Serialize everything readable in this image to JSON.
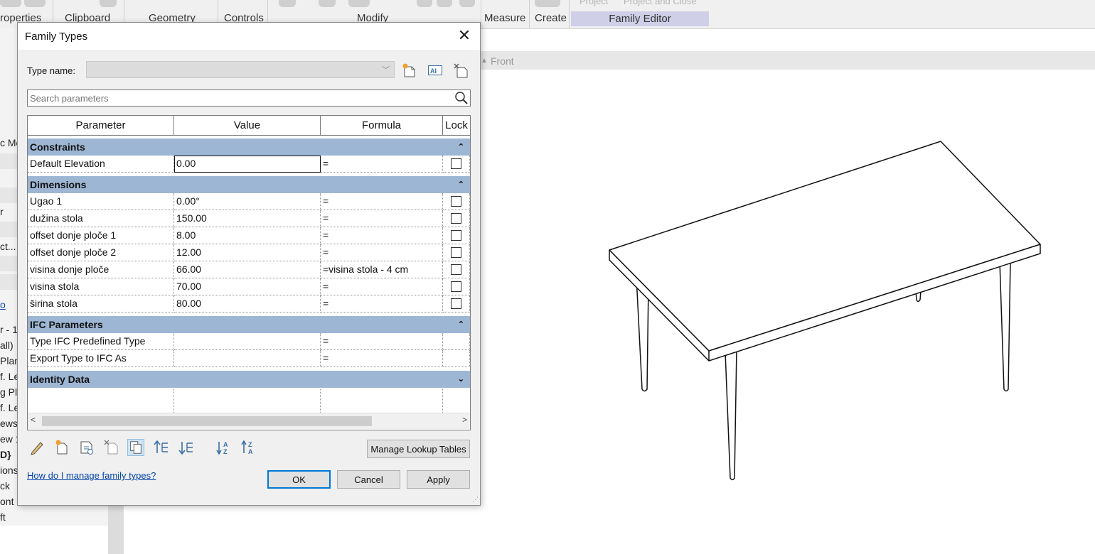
{
  "ribbon": {
    "groups": [
      "roperties",
      "Clipboard",
      "Geometry",
      "Controls",
      "Modify",
      "Measure",
      "Create",
      "Family Editor"
    ],
    "faded_labels": [
      "Project",
      "Project and Close"
    ]
  },
  "left_panel": {
    "fragments": [
      "c Mo",
      "r",
      "ct...",
      "o",
      "r - 1",
      "all)",
      "Plan",
      "f. Le",
      "g Pla",
      "f. Le",
      "ews",
      "ew 1",
      "D}",
      "ions",
      "ck",
      "ont",
      "ft"
    ]
  },
  "view": {
    "tab_label": "Front"
  },
  "dialog": {
    "title": "Family Types",
    "close_glyph": "✕",
    "type_name_label": "Type name:",
    "type_name_value": "",
    "search_placeholder": "Search parameters",
    "columns": [
      "Parameter",
      "Value",
      "Formula",
      "Lock"
    ],
    "groups": [
      {
        "name": "Constraints",
        "collapse_glyph": "⌃",
        "rows": [
          {
            "param": "Default Elevation",
            "value": "0.00",
            "formula": "=",
            "lock": true
          }
        ]
      },
      {
        "name": "Dimensions",
        "collapse_glyph": "⌃",
        "rows": [
          {
            "param": "Ugao 1",
            "value": "0.00°",
            "formula": "=",
            "lock": true
          },
          {
            "param": "dužina stola",
            "value": "150.00",
            "formula": "=",
            "lock": true
          },
          {
            "param": "offset donje ploče 1",
            "value": "8.00",
            "formula": "=",
            "lock": true
          },
          {
            "param": "offset donje ploče 2",
            "value": "12.00",
            "formula": "=",
            "lock": true
          },
          {
            "param": "visina donje ploče",
            "value": "66.00",
            "formula": "=visina stola - 4 cm",
            "lock": true
          },
          {
            "param": "visina stola",
            "value": "70.00",
            "formula": "=",
            "lock": true
          },
          {
            "param": "širina stola",
            "value": "80.00",
            "formula": "=",
            "lock": true
          }
        ]
      },
      {
        "name": "IFC Parameters",
        "collapse_glyph": "⌃",
        "rows": [
          {
            "param": "Type IFC Predefined Type",
            "value": "",
            "formula": "=",
            "lock": false
          },
          {
            "param": "Export Type to IFC As",
            "value": "",
            "formula": "=",
            "lock": false
          }
        ]
      },
      {
        "name": "Identity Data",
        "collapse_glyph": "⌄",
        "rows": []
      }
    ],
    "manage_lookup_label": "Manage Lookup Tables",
    "help_link": "How do I manage family types?",
    "ok_label": "OK",
    "cancel_label": "Cancel",
    "apply_label": "Apply",
    "bottom_icons": [
      "pencil-icon",
      "new-parameter-icon",
      "shared-parameter-icon",
      "delete-parameter-icon",
      "copy-parameter-icon",
      "move-up-icon",
      "move-down-icon",
      "sort-ascending-icon",
      "sort-descending-icon"
    ],
    "toolbar_icons": [
      "new-type-icon",
      "rename-type-icon",
      "delete-type-icon"
    ]
  }
}
